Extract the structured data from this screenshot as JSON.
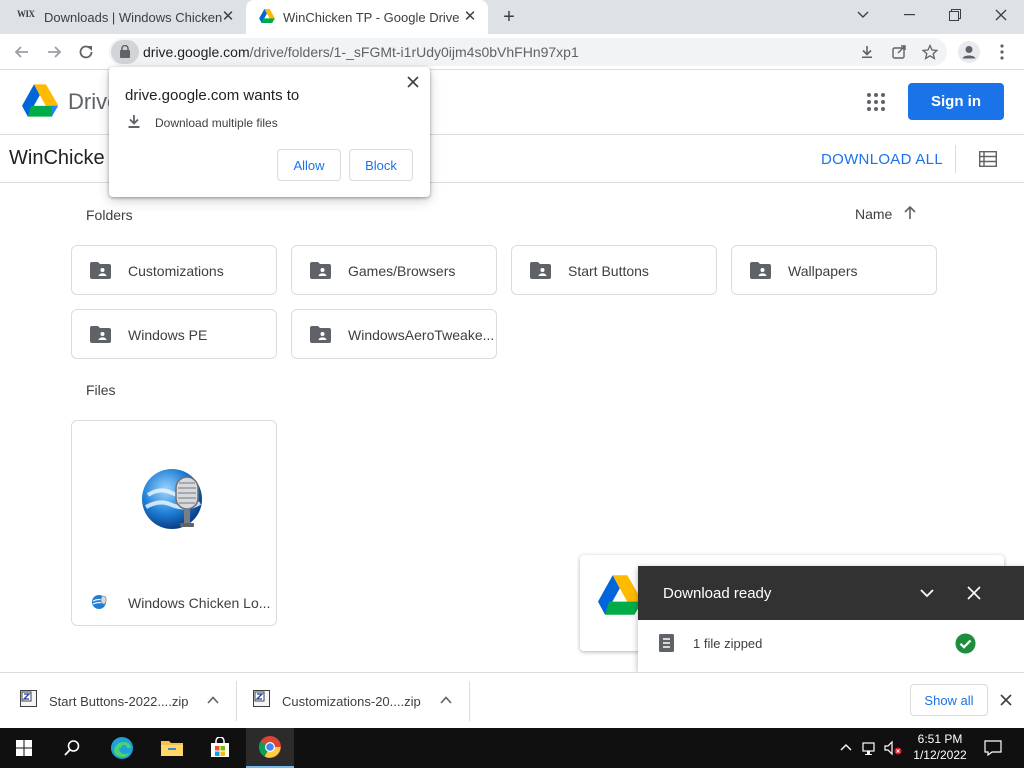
{
  "browser": {
    "tabs": [
      {
        "label": "Downloads | Windows Chicken",
        "favicon_text": "WIX"
      },
      {
        "label": "WinChicken TP - Google Drive"
      }
    ],
    "url_host": "drive.google.com",
    "url_path": "/drive/folders/1-_sFGMt-i1rUdy0ijm4s0bVhFHn97xp1"
  },
  "drive": {
    "product_name": "Drive",
    "signin_label": "Sign in",
    "folder_title": "WinChicke",
    "download_all_label": "DOWNLOAD ALL",
    "folders_label": "Folders",
    "sort_label": "Name",
    "files_label": "Files",
    "folders": [
      {
        "name": "Customizations"
      },
      {
        "name": "Games/Browsers"
      },
      {
        "name": "Start Buttons"
      },
      {
        "name": "Wallpapers"
      },
      {
        "name": "Windows PE"
      },
      {
        "name": "WindowsAeroTweake..."
      }
    ],
    "files": [
      {
        "name": "Windows Chicken Lo..."
      }
    ]
  },
  "permission_popup": {
    "title": "drive.google.com wants to",
    "request": "Download multiple files",
    "allow_label": "Allow",
    "block_label": "Block"
  },
  "download_toast": {
    "title": "Download ready",
    "item": "1 file zipped"
  },
  "download_shelf": {
    "items": [
      {
        "name": "Start Buttons-2022....zip"
      },
      {
        "name": "Customizations-20....zip"
      }
    ],
    "show_all_label": "Show all"
  },
  "taskbar": {
    "time": "6:51 PM",
    "date": "1/12/2022"
  },
  "colors": {
    "accent": "#1a73e8",
    "toast_header": "#323232",
    "success": "#1e8e3e"
  }
}
